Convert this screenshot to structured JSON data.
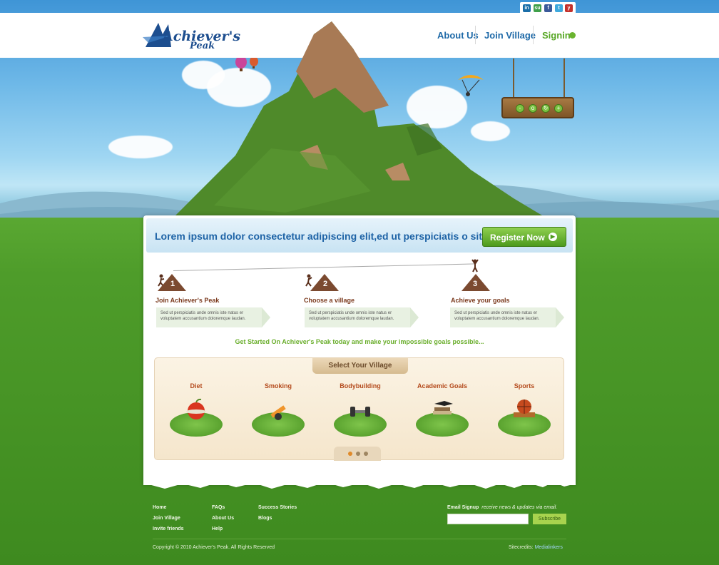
{
  "brand": {
    "name_line1": "Achiever's",
    "name_line2": "Peak"
  },
  "social": [
    "linkedin-icon",
    "stumbleupon-icon",
    "facebook-icon",
    "twitter-icon",
    "youtube-icon"
  ],
  "nav": {
    "about": "About Us",
    "join": "Join Village",
    "signin": "Signin"
  },
  "banner": {
    "text": "Lorem ipsum dolor consectetur adipiscing elit,ed ut perspiciatis o sit.",
    "button": "Register Now"
  },
  "steps": [
    {
      "num": "1",
      "title": "Join Achiever's Peak",
      "text": "Sed ut perspiciatis unde omnis iste natus er voluptatem accusantium doloremque laudan."
    },
    {
      "num": "2",
      "title": "Choose a village",
      "text": "Sed ut perspiciatis unde omnis iste natus er voluptatem accusantium doloremque laudan."
    },
    {
      "num": "3",
      "title": "Achieve your goals",
      "text": "Sed ut perspiciatis unde omnis iste natus er voluptatem accusantium doloremque laudan."
    }
  ],
  "cta": "Get Started On Achiever's Peak today and make your impossible goals possible...",
  "village": {
    "title": "Select Your Village",
    "items": [
      {
        "label": "Diet",
        "icon": "apple-icon"
      },
      {
        "label": "Smoking",
        "icon": "cigarette-icon"
      },
      {
        "label": "Bodybuilding",
        "icon": "dumbbell-icon"
      },
      {
        "label": "Academic Goals",
        "icon": "books-icon"
      },
      {
        "label": "Sports",
        "icon": "basketball-icon"
      }
    ]
  },
  "footer": {
    "col1": [
      "Home",
      "Join Village",
      "Invite friends"
    ],
    "col2": [
      "FAQs",
      "About Us",
      "Help"
    ],
    "col3": [
      "Success Stories",
      "Blogs"
    ],
    "email_label": "Email Signup",
    "email_hint": "receive news & updates via email.",
    "subscribe": "Subscribe",
    "copyright": "Copyright © 2010 Achiever's Peak. All Rights Reserved",
    "credits_label": "Sitecredits:",
    "credits_link": "Medialinkers"
  }
}
